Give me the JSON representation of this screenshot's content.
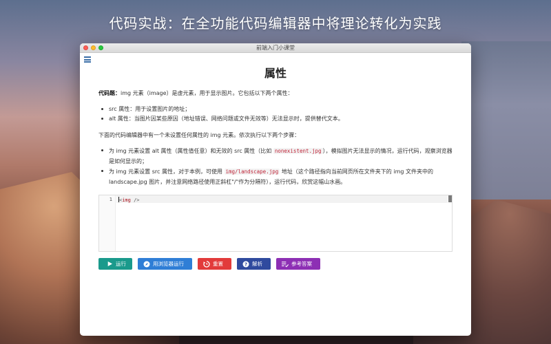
{
  "banner": "代码实战：在全功能代码编辑器中将理论转化为实践",
  "window": {
    "title": "前端入门小课堂"
  },
  "lesson": {
    "heading": "属性",
    "intro_label": "代码题：",
    "intro_text": "img 元素（image）是虚元素，用于显示图片。它包括以下两个属性：",
    "attributes": [
      "src 属性：用于设置图片的地址；",
      "alt 属性：当图片因某些原因（地址错误、网络问题或文件无效等）无法显示时，提供替代文本。"
    ],
    "task_intro": "下面的代码编辑器中有一个未设置任何属性的 img 元素。依次执行以下两个步骤：",
    "step1": {
      "before": "为 img 元素设置 alt 属性（属性值任意）和无效的 src 属性（比如 ",
      "code": "nonexistent.jpg",
      "after": "），模拟图片无法显示的情况，运行代码，观察浏览器是如何显示的；"
    },
    "step2": {
      "before": "为 img 元素设置 src 属性，对于本例，可使用 ",
      "code": "img/landscape.jpg",
      "after": " 地址（这个路径指向当前网页所在文件夹下的 img 文件夹中的 landscape.jpg 图片，并注意网络路径使用正斜杠\"/\"作为分隔符），运行代码，欣赏这幅山水画。"
    }
  },
  "editor": {
    "line_number": "1",
    "code_open": "<",
    "code_tag": "img",
    "code_close": " />"
  },
  "buttons": {
    "run": "运行",
    "run_browser": "用浏览器运行",
    "reset": "重置",
    "explain": "解析",
    "answer": "参考答案"
  },
  "colors": {
    "run": "#1a9a8c",
    "run_browser": "#2f7ed6",
    "reset": "#e23b3b",
    "explain": "#2f4a9e",
    "answer": "#8d2fb4"
  },
  "icons": {
    "menu": "list-menu-icon",
    "run": "play-icon",
    "run_browser": "compass-icon",
    "reset": "reset-icon",
    "explain": "help-icon",
    "answer": "checklist-icon"
  }
}
